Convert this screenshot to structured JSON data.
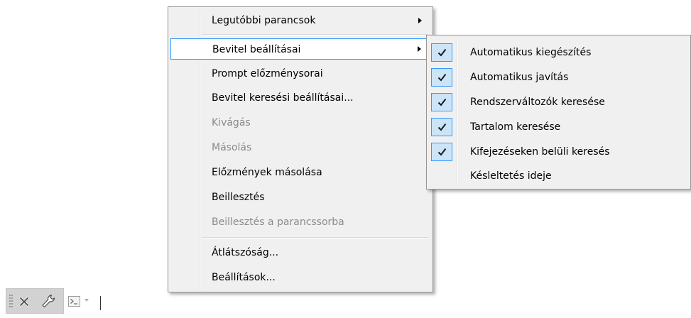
{
  "context_menu": {
    "items": [
      {
        "label": "Legutóbbi parancsok",
        "submenu": true,
        "disabled": false
      },
      {
        "label": "Bevitel beállításai",
        "submenu": true,
        "disabled": false,
        "highlighted": true
      },
      {
        "label": "Prompt előzménysorai",
        "disabled": false
      },
      {
        "label": "Bevitel keresési beállításai...",
        "disabled": false
      },
      {
        "label": "Kivágás",
        "disabled": true
      },
      {
        "label": "Másolás",
        "disabled": true
      },
      {
        "label": "Előzmények másolása",
        "disabled": false
      },
      {
        "label": "Beillesztés",
        "disabled": false
      },
      {
        "label": "Beillesztés a parancssorba",
        "disabled": true
      },
      {
        "label": "Átlátszóság...",
        "disabled": false
      },
      {
        "label": "Beállítások...",
        "disabled": false
      }
    ]
  },
  "submenu": {
    "items": [
      {
        "label": "Automatikus kiegészítés",
        "checked": true
      },
      {
        "label": "Automatikus javítás",
        "checked": true
      },
      {
        "label": "Rendszerváltozók keresése",
        "checked": true
      },
      {
        "label": "Tartalom keresése",
        "checked": true
      },
      {
        "label": "Kifejezéseken belüli keresés",
        "checked": true
      },
      {
        "label": "Késleltetés ideje",
        "checked": false
      }
    ]
  },
  "command_line": {
    "input_value": "",
    "icons": [
      "grip-icon",
      "close-icon",
      "wrench-icon",
      "command-prompt-icon",
      "dropdown-arrow-icon"
    ]
  },
  "colors": {
    "menu_bg": "#f0f0f0",
    "highlight_border": "#3399ff",
    "check_bg": "#cce4f7",
    "disabled_text": "#8a8a8a",
    "toolbar_bg": "#d2d2d2"
  }
}
